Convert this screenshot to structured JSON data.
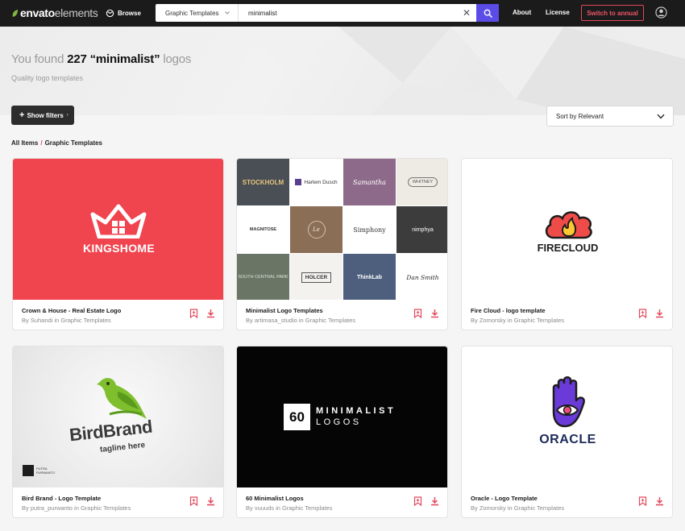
{
  "topbar": {
    "logo_strong": "envato",
    "logo_light": "elements",
    "browse": "Browse",
    "search_category": "Graphic Templates",
    "search_value": "minimalist",
    "about": "About",
    "license": "License",
    "annual": "Switch to annual"
  },
  "hero": {
    "prefix": "You found ",
    "count": "227 “minimalist”",
    "suffix": " logos",
    "subtitle": "Quality logo templates"
  },
  "controls": {
    "filters": "Show filters",
    "sort": "Sort by Relevant"
  },
  "breadcrumb": {
    "root": "All Items",
    "current": "Graphic Templates"
  },
  "colors": {
    "accent": "#5b4ce8",
    "download_red": "#e24a5c",
    "kingshome_red": "#f0444f"
  },
  "cards": [
    {
      "title": "Crown & House - Real Estate Logo",
      "author": "By Suhandi in Graphic Templates",
      "thumb_text": "KINGSHOME"
    },
    {
      "title": "Minimalist Logo Templates",
      "author": "By artimasa_studio in Graphic Templates",
      "tiles": [
        "STOCKHOLM",
        "Harlem Dusch",
        "Samantha",
        "WHITNEY",
        "MAGNITOSE",
        "Le",
        "Simphony",
        "nimphya",
        "SOUTH CENTRAL PARK",
        "HOLCER",
        "ThinkLab",
        "Dan Smith"
      ]
    },
    {
      "title": "Fire Cloud - logo template",
      "author": "By Zomorsky in Graphic Templates",
      "thumb_text": "FIRECLOUD"
    },
    {
      "title": "Bird Brand - Logo Template",
      "author": "By putra_purwanto in Graphic Templates",
      "thumb_text": "BirdBrand",
      "thumb_tagline": "tagline here",
      "thumb_badge": "PUTRA PURWANTO"
    },
    {
      "title": "60 Minimalist Logos",
      "author": "By vuuuds in Graphic Templates",
      "thumb_number": "60",
      "thumb_line1": "MINIMALIST",
      "thumb_line2": "LOGOS"
    },
    {
      "title": "Oracle - Logo Template",
      "author": "By Zomorsky in Graphic Templates",
      "thumb_text": "ORACLE"
    }
  ]
}
